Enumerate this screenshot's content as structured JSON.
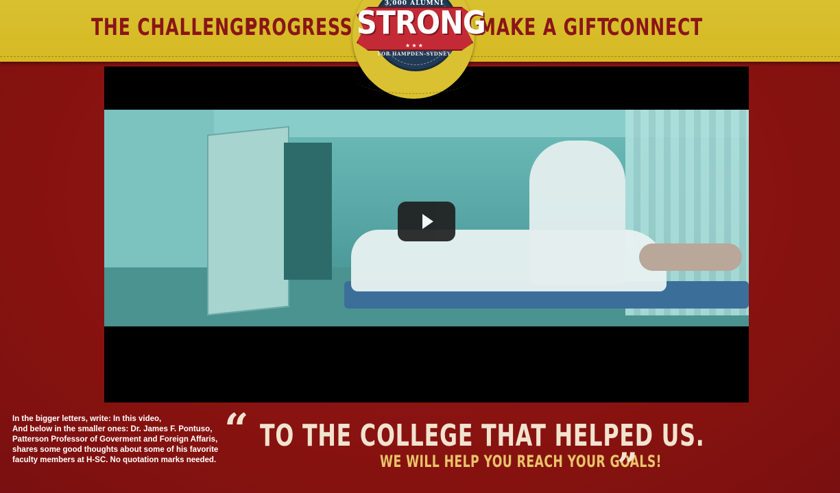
{
  "nav": {
    "challenge": "THE CHALLENGE",
    "progress": "PROGRESS",
    "gift": "MAKE A GIFT",
    "connect": "CONNECT"
  },
  "logo": {
    "word": "STRONG",
    "top_text": "3,000 ALUMNI",
    "bottom_text": "FOR HAMPDEN-SYDNEY",
    "stars": "★ ★ ★"
  },
  "video": {
    "play_icon": "play-icon"
  },
  "note_text": "In the bigger letters, write: In this video,\nAnd below in the smaller ones: Dr. James F. Pontuso, Patterson Professor of Goverment and Foreign Affaris, shares some good thoughts about some of his favorite faculty members at H-SC. No quotation marks needed.",
  "quote": {
    "open_mark": "“",
    "close_mark": "”",
    "headline": "TO THE COLLEGE THAT HELPED US.",
    "subline": "WE WILL HELP YOU REACH YOUR GOALS!"
  },
  "colors": {
    "background": "#8c1416",
    "nav_bar": "#d9bf2a",
    "nav_text": "#8a1517",
    "quote_text": "#f2e3cf",
    "subline_text": "#e8c46a"
  }
}
